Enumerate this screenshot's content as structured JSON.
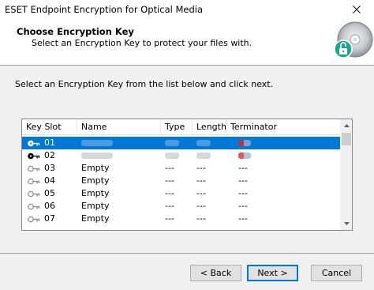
{
  "window": {
    "title": "ESET Endpoint Encryption for Optical Media"
  },
  "header": {
    "title": "Choose Encryption Key",
    "subtitle": "Select an Encryption Key to protect your files with."
  },
  "instruction": "Select an Encryption Key from the list below and click next.",
  "table": {
    "columns": [
      "Key Slot",
      "Name",
      "Type",
      "Length",
      "Terminator"
    ],
    "rows": [
      {
        "slot": "01",
        "name": "",
        "type": "",
        "length": "",
        "terminator": "",
        "selected": true,
        "key_icon": "key-dark-icon"
      },
      {
        "slot": "02",
        "name": "",
        "type": "",
        "length": "",
        "terminator": "",
        "selected": false,
        "key_icon": "key-dark-icon"
      },
      {
        "slot": "03",
        "name": "Empty",
        "type": "---",
        "length": "---",
        "terminator": "---",
        "selected": false,
        "key_icon": "key-empty-icon"
      },
      {
        "slot": "04",
        "name": "Empty",
        "type": "---",
        "length": "---",
        "terminator": "---",
        "selected": false,
        "key_icon": "key-empty-icon"
      },
      {
        "slot": "05",
        "name": "Empty",
        "type": "---",
        "length": "---",
        "terminator": "---",
        "selected": false,
        "key_icon": "key-empty-icon"
      },
      {
        "slot": "06",
        "name": "Empty",
        "type": "---",
        "length": "---",
        "terminator": "---",
        "selected": false,
        "key_icon": "key-empty-icon"
      },
      {
        "slot": "07",
        "name": "Empty",
        "type": "---",
        "length": "---",
        "terminator": "---",
        "selected": false,
        "key_icon": "key-empty-icon"
      }
    ]
  },
  "buttons": {
    "back": "< Back",
    "next": "Next >",
    "cancel": "Cancel"
  },
  "colors": {
    "selection": "#0078d7",
    "dialog_bg": "#f0f0f0"
  }
}
